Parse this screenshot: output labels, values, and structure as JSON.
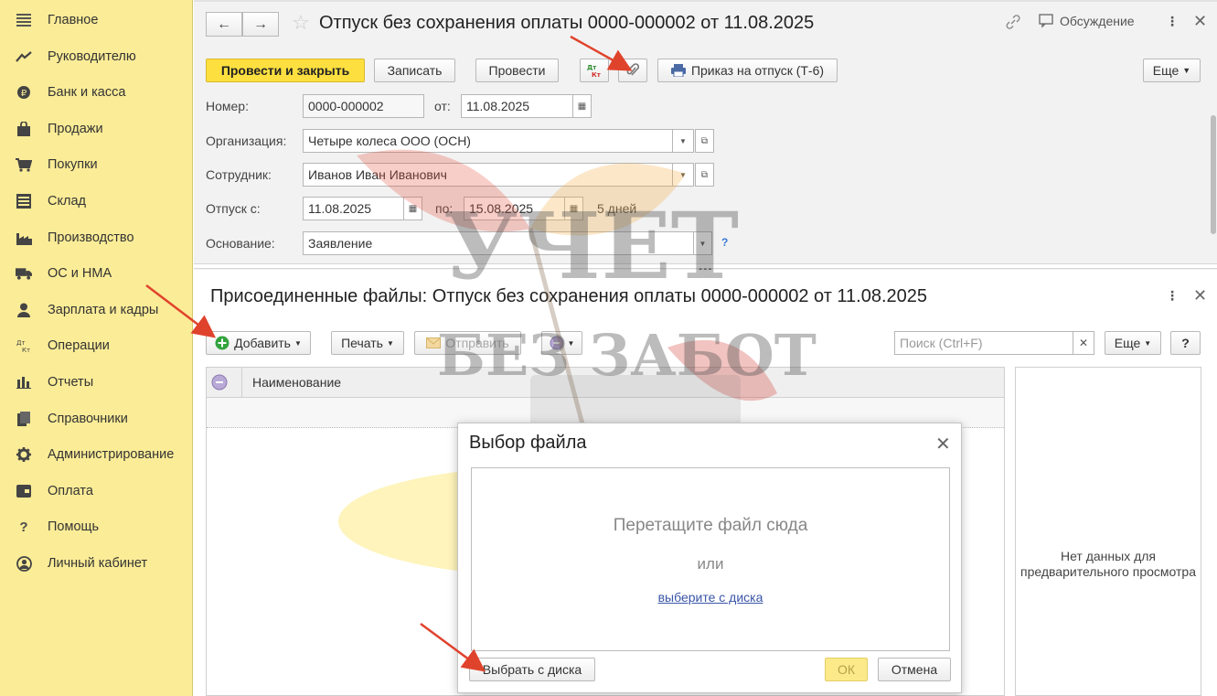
{
  "sidebar": {
    "items": [
      {
        "label": "Главное",
        "icon": "menu-lines-icon"
      },
      {
        "label": "Руководителю",
        "icon": "trend-icon"
      },
      {
        "label": "Банк и касса",
        "icon": "bank-coin-icon"
      },
      {
        "label": "Продажи",
        "icon": "shopping-bag-icon"
      },
      {
        "label": "Покупки",
        "icon": "cart-icon"
      },
      {
        "label": "Склад",
        "icon": "warehouse-icon"
      },
      {
        "label": "Производство",
        "icon": "factory-icon"
      },
      {
        "label": "ОС и НМА",
        "icon": "truck-icon"
      },
      {
        "label": "Зарплата и кадры",
        "icon": "person-icon"
      },
      {
        "label": "Операции",
        "icon": "dt-kt-icon"
      },
      {
        "label": "Отчеты",
        "icon": "bar-chart-icon"
      },
      {
        "label": "Справочники",
        "icon": "books-icon"
      },
      {
        "label": "Администрирование",
        "icon": "gear-icon"
      },
      {
        "label": "Оплата",
        "icon": "payment-icon"
      },
      {
        "label": "Помощь",
        "icon": "question-icon"
      },
      {
        "label": "Личный кабинет",
        "icon": "user-circle-icon"
      }
    ]
  },
  "header": {
    "title": "Отпуск без сохранения оплаты 0000-000002 от 11.08.2025",
    "discussion": "Обсуждение"
  },
  "toolbar": {
    "post_close": "Провести и закрыть",
    "save": "Записать",
    "post": "Провести",
    "dt_kt": "Дт Кт",
    "order": "Приказ на отпуск (Т-6)",
    "more": "Еще"
  },
  "form": {
    "number_label": "Номер:",
    "number_value": "0000-000002",
    "from_label": "от:",
    "date_value": "11.08.2025",
    "org_label": "Организация:",
    "org_value": "Четыре колеса ООО (ОСН)",
    "employee_label": "Сотрудник:",
    "employee_value": "Иванов Иван Иванович",
    "vacation_label": "Отпуск с:",
    "vacation_from": "11.08.2025",
    "to_label": "по:",
    "vacation_to": "15.08.2025",
    "days": "5 дней",
    "basis_label": "Основание:",
    "basis_value": "Заявление"
  },
  "files": {
    "title": "Присоединенные файлы: Отпуск без сохранения оплаты 0000-000002 от 11.08.2025",
    "add": "Добавить",
    "print": "Печать",
    "send": "Отправить",
    "search_placeholder": "Поиск (Ctrl+F)",
    "more": "Еще",
    "help": "?",
    "col_name": "Наименование",
    "preview_text": "Нет данных для предварительного просмотра"
  },
  "dialog": {
    "title": "Выбор файла",
    "drop_text": "Перетащите файл сюда",
    "or_text": "или",
    "link_text": "выберите с диска",
    "choose_button": "Выбрать с диска",
    "ok": "ОК",
    "cancel": "Отмена"
  },
  "watermark": {
    "line1": "УЧЕТ",
    "line2": "БЕЗ ЗАБОТ"
  },
  "colors": {
    "sidebar": "#fbec97",
    "primary": "#fde040",
    "arrow": "#e0432c",
    "link": "#3a55a8"
  }
}
